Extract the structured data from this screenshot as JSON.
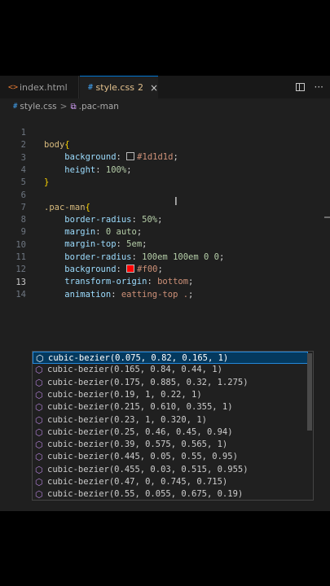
{
  "tabs": [
    {
      "icon": "<>",
      "label": "index.html"
    },
    {
      "icon": "#",
      "label": "style.css",
      "badge": "2",
      "close": "×"
    }
  ],
  "breadcrumb": {
    "file": "style.css",
    "separator": ">",
    "selector": ".pac-man"
  },
  "code": {
    "ln1": "1",
    "ln2": "2",
    "ln3": "3",
    "ln4": "4",
    "ln5": "5",
    "ln6": "6",
    "ln7": "7",
    "ln8": "8",
    "ln9": "9",
    "ln10": "10",
    "ln11": "11",
    "ln12": "12",
    "ln13": "13",
    "ln14": "14",
    "l1_sel": "body",
    "l1_brace": "{",
    "l2_prop": "background",
    "l2_val": "#1d1d1d",
    "l2_color": "#1d1d1d",
    "l3_prop": "height",
    "l3_val": "100%",
    "l4_brace": "}",
    "l6_sel": ".pac-man",
    "l6_brace": "{",
    "l7_prop": "border-radius",
    "l7_val": "50%",
    "l8_prop": "margin",
    "l8_val": "0 auto",
    "l9_prop": "margin-top",
    "l9_val": "5em",
    "l10_prop": "border-radius",
    "l10_val": "100em 100em 0 0",
    "l11_prop": "background",
    "l11_val": "#f00",
    "l11_color": "#ff0000",
    "l12_prop": "transform-origin",
    "l12_val": "bottom",
    "l13_prop": "animation",
    "l13_val": "eatting-top .",
    "colon": ":",
    "semi": ";"
  },
  "suggestions": [
    "cubic-bezier(0.075, 0.82, 0.165, 1)",
    "cubic-bezier(0.165, 0.84, 0.44, 1)",
    "cubic-bezier(0.175, 0.885, 0.32, 1.275)",
    "cubic-bezier(0.19, 1, 0.22, 1)",
    "cubic-bezier(0.215, 0.610, 0.355, 1)",
    "cubic-bezier(0.23, 1, 0.320, 1)",
    "cubic-bezier(0.25, 0.46, 0.45, 0.94)",
    "cubic-bezier(0.39, 0.575, 0.565, 1)",
    "cubic-bezier(0.445, 0.05, 0.55, 0.95)",
    "cubic-bezier(0.455, 0.03, 0.515, 0.955)",
    "cubic-bezier(0.47, 0, 0.745, 0.715)",
    "cubic-bezier(0.55, 0.055, 0.675, 0.19)"
  ],
  "colors": {
    "editor_bg": "#1f1f1f",
    "accent": "#0078d4",
    "selector": "#d7ba7d",
    "property": "#9cdcfe",
    "value": "#ce9178"
  }
}
